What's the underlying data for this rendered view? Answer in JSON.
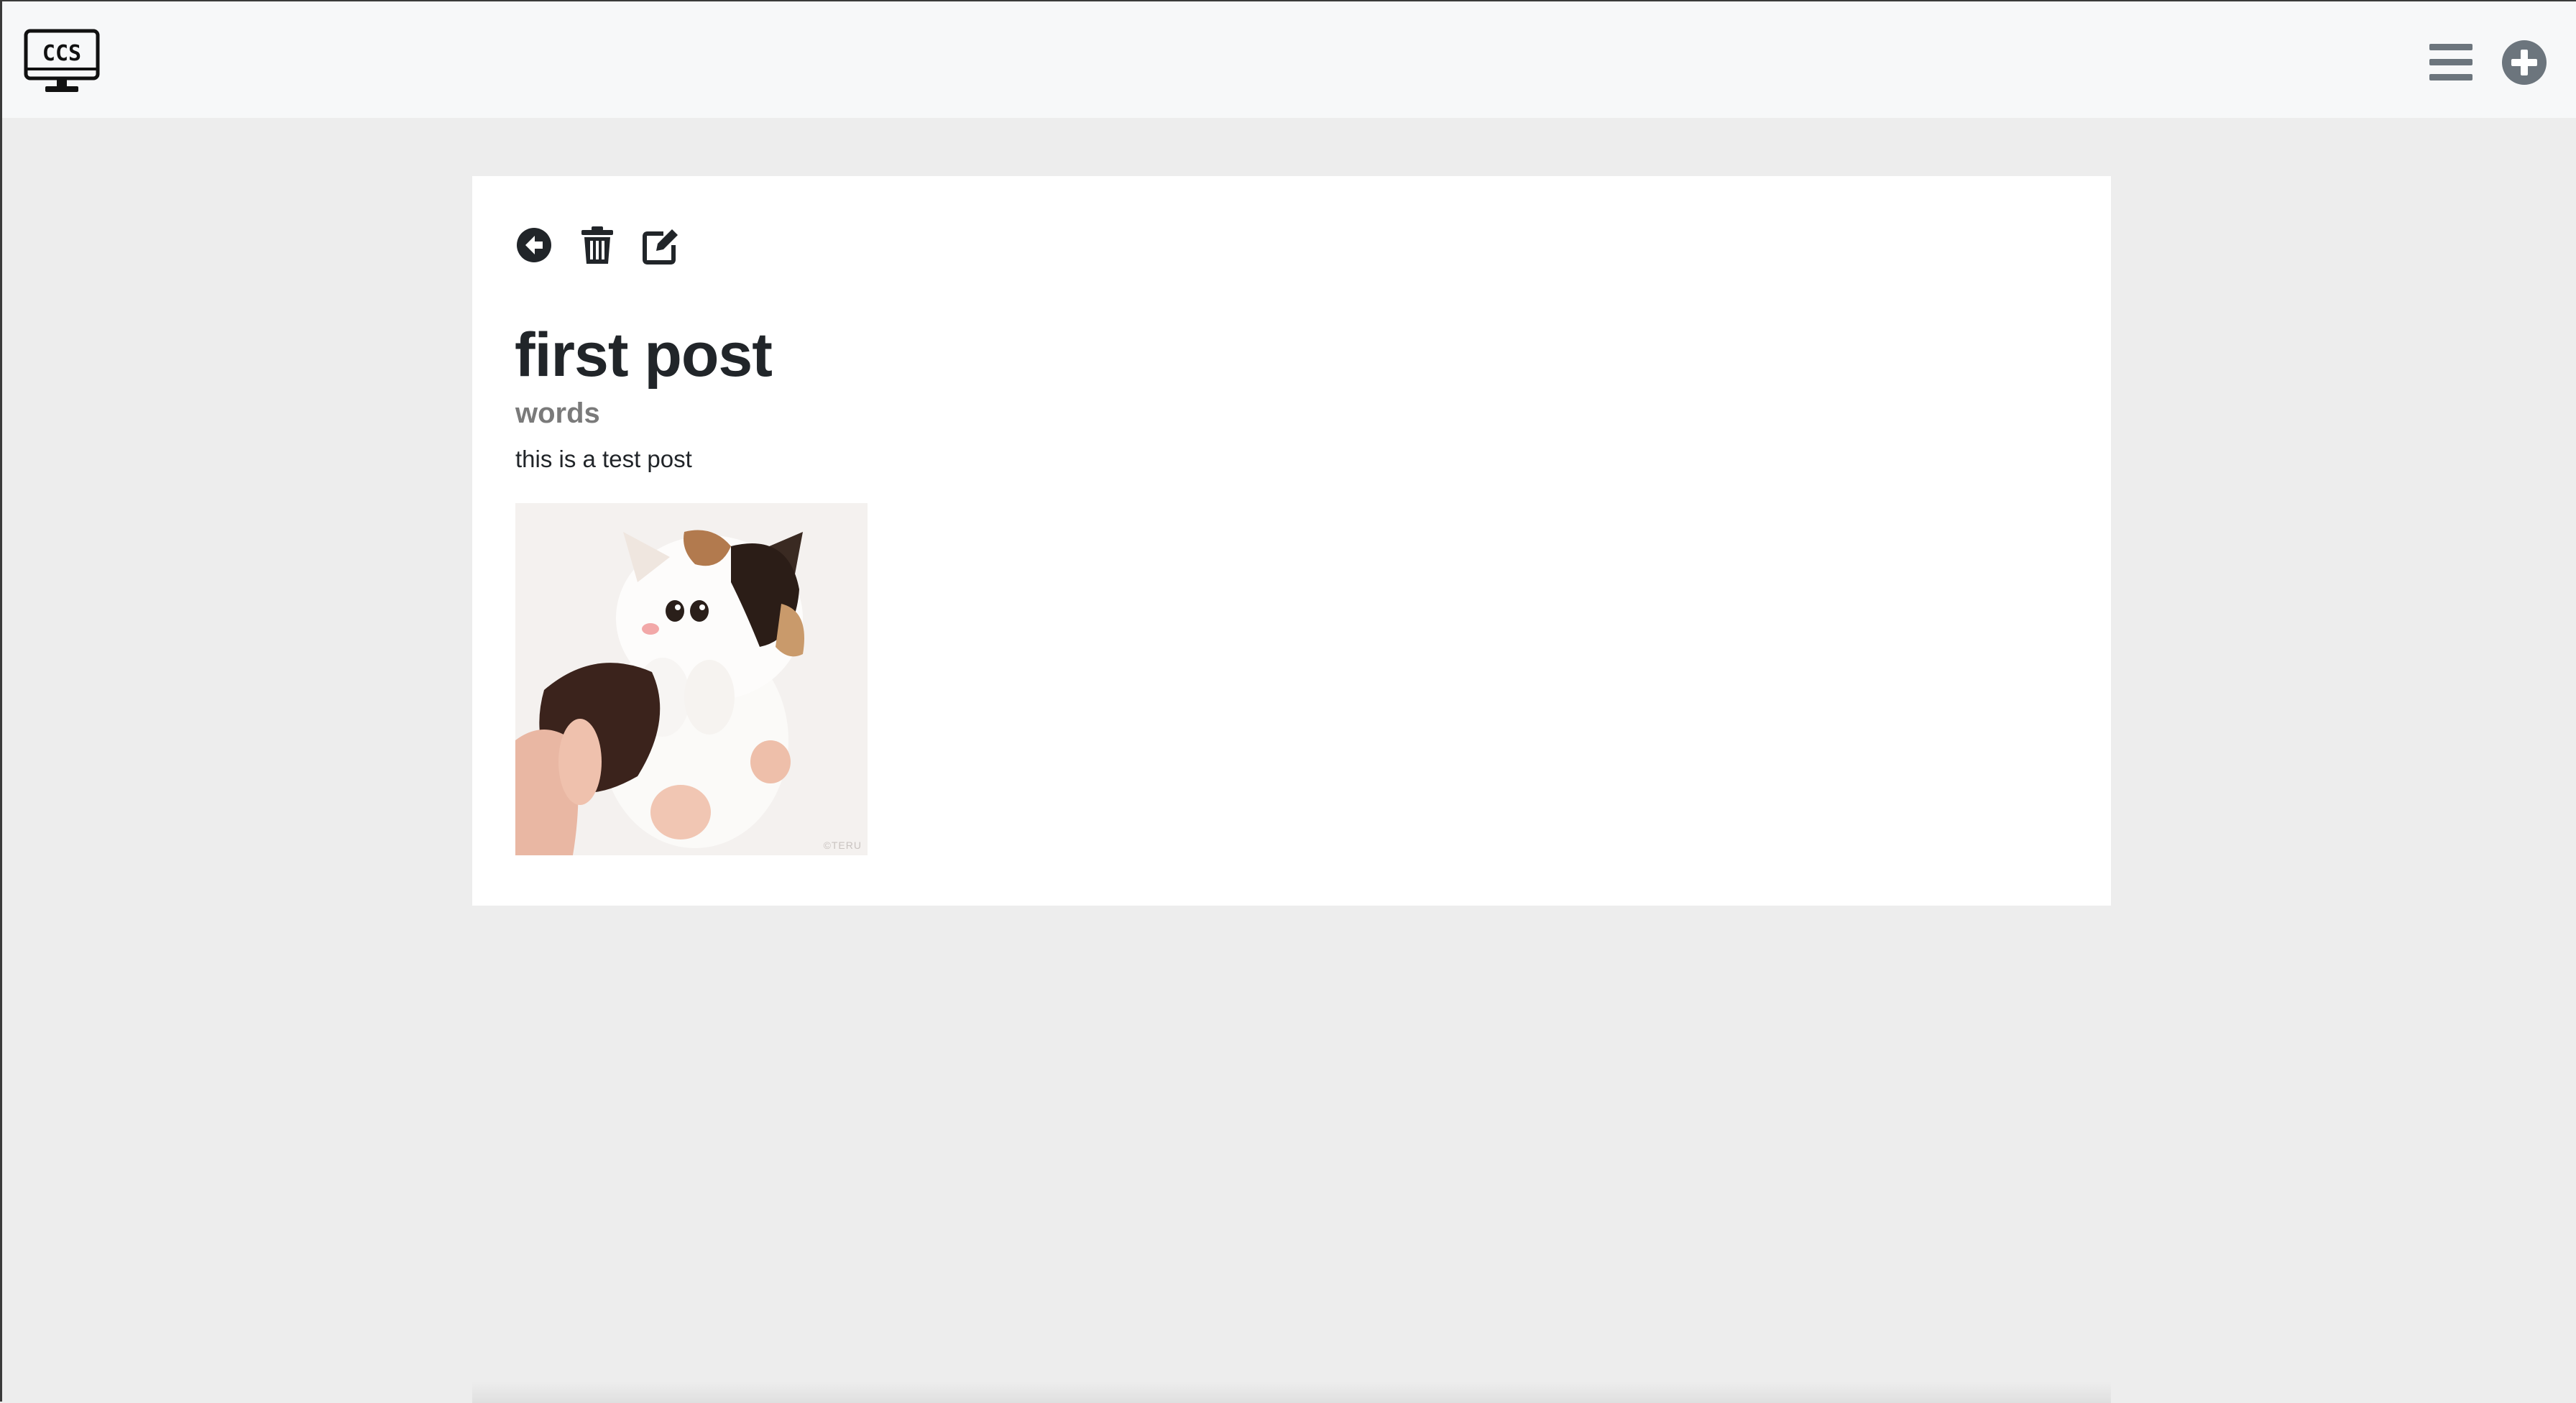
{
  "navbar": {
    "logo_text": "CCS",
    "logo_icon": "monitor-logo-icon",
    "menu_icon": "hamburger-menu-icon",
    "add_icon": "plus-circle-icon"
  },
  "post": {
    "actions": {
      "back_icon": "arrow-left-circle-icon",
      "delete_icon": "trash-icon",
      "edit_icon": "edit-icon"
    },
    "title": "first post",
    "subtitle": "words",
    "body": "this is a test post",
    "image": {
      "subject": "kitten held in hand",
      "watermark": "©TERU"
    }
  },
  "colors": {
    "navbar_bg": "#f7f8f9",
    "page_bg": "#ededed",
    "card_bg": "#ffffff",
    "icon_dark": "#212529",
    "icon_grey": "#6c757d",
    "subtitle": "#7a7a7a"
  }
}
